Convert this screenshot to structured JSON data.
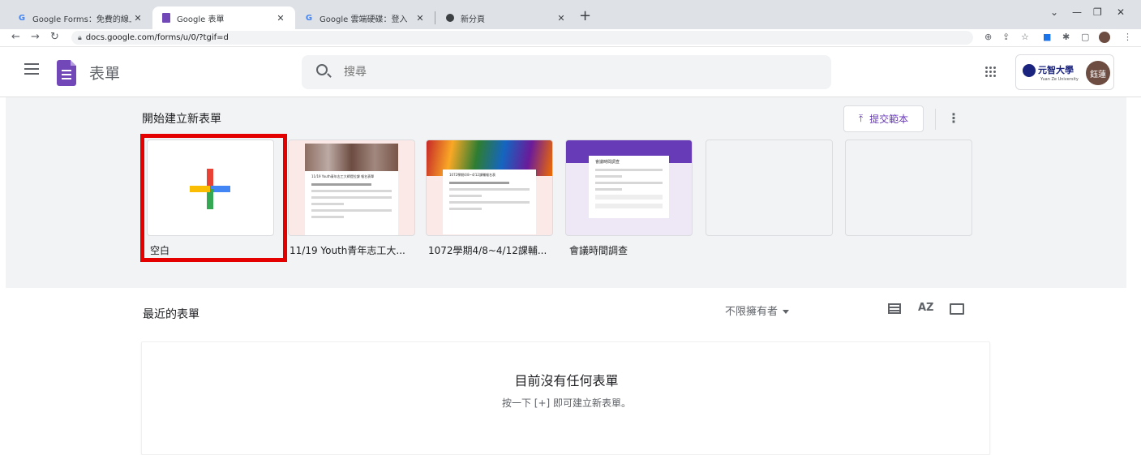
{
  "browser": {
    "tabs": [
      {
        "label": "Google Forms：免費的線上表單",
        "favicon": "G"
      },
      {
        "label": "Google 表單",
        "favicon": "form-icon"
      },
      {
        "label": "Google 雲端硬碟：登入",
        "favicon": "G"
      },
      {
        "label": "新分頁",
        "favicon": "chrome-icon"
      }
    ],
    "url": "docs.google.com/forms/u/0/?tgif=d"
  },
  "app": {
    "title": "表單",
    "search_placeholder": "搜尋",
    "university_name": "元智大學",
    "university_subtitle": "Yuan Ze University",
    "avatar_text": "鈺蓮"
  },
  "gallery": {
    "title": "開始建立新表單",
    "submit_button": "提交範本",
    "templates": [
      {
        "label": "空白"
      },
      {
        "label": "11/19 Youth青年志工大...",
        "preview_title": "11/19 Youth青年志工大師提拉課 報名表單"
      },
      {
        "label": "1072學期4/8~4/12課輔...",
        "preview_title": "1072學期4/8~4/12課輔報名表"
      },
      {
        "label": "會議時間調查",
        "preview_title": "會議時間調查"
      },
      {
        "label": ""
      },
      {
        "label": ""
      }
    ]
  },
  "recent": {
    "title": "最近的表單",
    "owner_filter": "不限擁有者",
    "sort_icon_label": "AZ",
    "empty_title": "目前沒有任何表單",
    "empty_subtitle": "按一下 [+] 即可建立新表單。"
  },
  "colors": {
    "accent": "#673ab7",
    "highlight_box": "#e50000",
    "gallery_bg": "#f1f3f4"
  }
}
